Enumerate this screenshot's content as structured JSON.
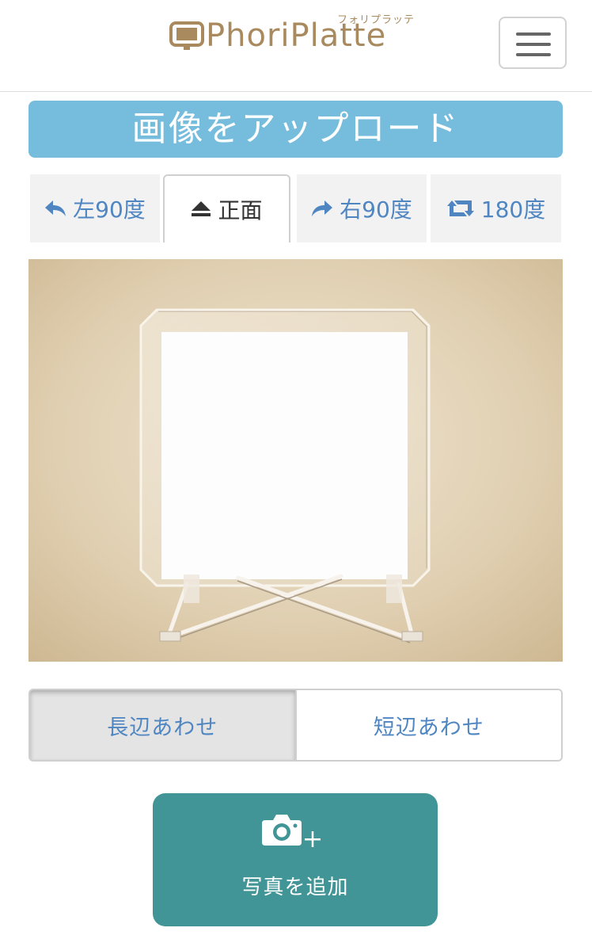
{
  "header": {
    "logo_text": "PhoriPlatte",
    "logo_ruby": "フォリプラッテ",
    "menu_icon": "hamburger-menu-icon"
  },
  "title": "画像をアップロード",
  "rotation_tabs": [
    {
      "label": "左90度",
      "icon": "rotate-left-icon",
      "active": false
    },
    {
      "label": "正面",
      "icon": "eject-up-icon",
      "active": true
    },
    {
      "label": "右90度",
      "icon": "rotate-right-icon",
      "active": false
    },
    {
      "label": "180度",
      "icon": "retweet-rotate-icon",
      "active": false
    }
  ],
  "fit_options": [
    {
      "label": "長辺あわせ",
      "active": true
    },
    {
      "label": "短辺あわせ",
      "active": false
    }
  ],
  "add_photo": {
    "label": "写真を追加",
    "icon": "camera-plus-icon"
  },
  "colors": {
    "title_bg": "#76bcdc",
    "brand": "#a88a5e",
    "link_blue": "#4f86c2",
    "add_button_bg": "#429597"
  }
}
